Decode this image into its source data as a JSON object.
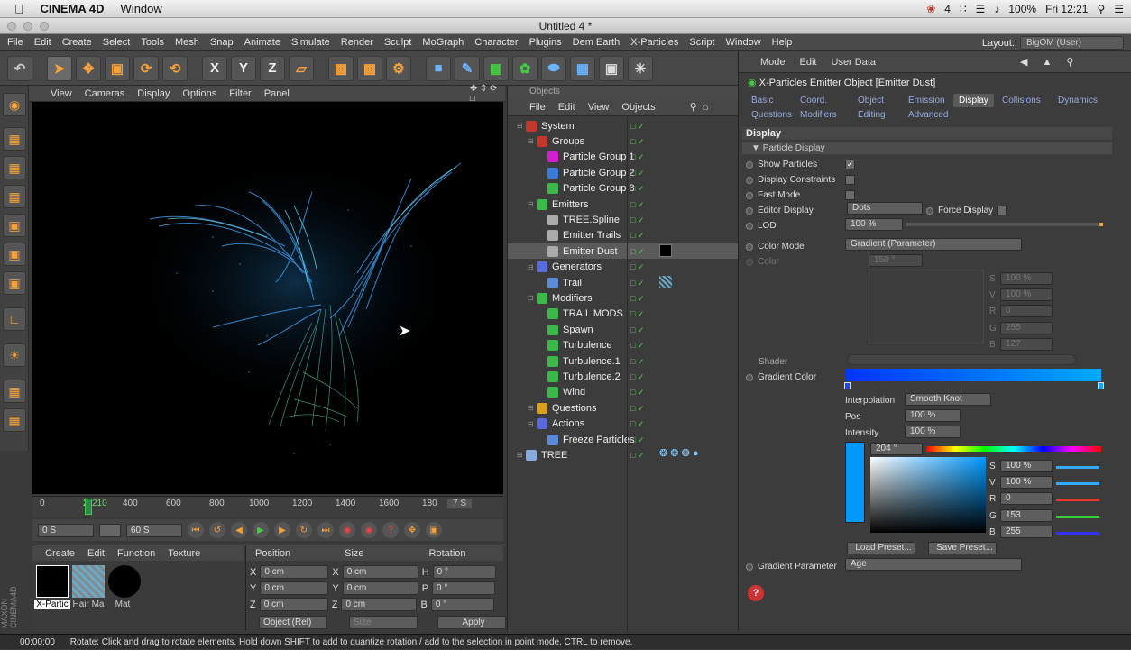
{
  "mac_menu": {
    "app": "CINEMA 4D",
    "window": "Window",
    "battery": "100%",
    "clock": "Fri 12:21",
    "counter": "4"
  },
  "window_title": "Untitled 4 *",
  "menu": [
    "File",
    "Edit",
    "Create",
    "Select",
    "Tools",
    "Mesh",
    "Snap",
    "Animate",
    "Simulate",
    "Render",
    "Sculpt",
    "MoGraph",
    "Character",
    "Plugins",
    "Dem Earth",
    "X-Particles",
    "Script",
    "Window",
    "Help"
  ],
  "layout": {
    "label": "Layout:",
    "value": "BigOM (User)"
  },
  "viewport_menu": [
    "View",
    "Cameras",
    "Display",
    "Options",
    "Filter",
    "Panel"
  ],
  "timeline": {
    "ticks": [
      "0",
      "2",
      "210",
      "400",
      "600",
      "800",
      "1000",
      "1200",
      "1400",
      "1600",
      "180"
    ],
    "frame_right": "7 S"
  },
  "playbar": {
    "start": "0 S",
    "end": "60 S"
  },
  "material_menu": [
    "Create",
    "Edit",
    "Function",
    "Texture"
  ],
  "materials": [
    {
      "label": "X-Partic"
    },
    {
      "label": "Hair Ma"
    },
    {
      "label": "Mat"
    }
  ],
  "coord": {
    "headers": [
      "Position",
      "Size",
      "Rotation"
    ],
    "rows": [
      {
        "a": "X",
        "pos": "0 cm",
        "b": "X",
        "size": "0 cm",
        "c": "H",
        "rot": "0 °"
      },
      {
        "a": "Y",
        "pos": "0 cm",
        "b": "Y",
        "size": "0 cm",
        "c": "P",
        "rot": "0 °"
      },
      {
        "a": "Z",
        "pos": "0 cm",
        "b": "Z",
        "size": "0 cm",
        "c": "B",
        "rot": "0 °"
      }
    ],
    "mode": "Object (Rel)",
    "size_mode": "Size",
    "apply": "Apply"
  },
  "objects": {
    "title": "Objects",
    "menu": [
      "File",
      "Edit",
      "View",
      "Objects"
    ],
    "tree": [
      {
        "name": "System",
        "indent": 0,
        "color": "#c0392b"
      },
      {
        "name": "Groups",
        "indent": 1,
        "color": "#c0392b"
      },
      {
        "name": "Particle Group 1",
        "indent": 2,
        "color": "#d020d0"
      },
      {
        "name": "Particle Group 2",
        "indent": 2,
        "color": "#3a7ad8"
      },
      {
        "name": "Particle Group 3",
        "indent": 2,
        "color": "#3ab84a"
      },
      {
        "name": "Emitters",
        "indent": 1,
        "color": "#3ab84a"
      },
      {
        "name": "TREE.Spline",
        "indent": 2,
        "color": "#aaaaaa"
      },
      {
        "name": "Emitter Trails",
        "indent": 2,
        "color": "#aaaaaa"
      },
      {
        "name": "Emitter Dust",
        "indent": 2,
        "color": "#aaaaaa"
      },
      {
        "name": "Generators",
        "indent": 1,
        "color": "#5a6ad8"
      },
      {
        "name": "Trail",
        "indent": 2,
        "color": "#5a8ad8"
      },
      {
        "name": "Modifiers",
        "indent": 1,
        "color": "#3ab84a"
      },
      {
        "name": "TRAIL MODS",
        "indent": 2,
        "color": "#3ab84a"
      },
      {
        "name": "Spawn",
        "indent": 2,
        "color": "#3ab84a"
      },
      {
        "name": "Turbulence",
        "indent": 2,
        "color": "#3ab84a"
      },
      {
        "name": "Turbulence.1",
        "indent": 2,
        "color": "#3ab84a"
      },
      {
        "name": "Turbulence.2",
        "indent": 2,
        "color": "#3ab84a"
      },
      {
        "name": "Wind",
        "indent": 2,
        "color": "#3ab84a"
      },
      {
        "name": "Questions",
        "indent": 1,
        "color": "#d8a020"
      },
      {
        "name": "Actions",
        "indent": 1,
        "color": "#5a6ad8"
      },
      {
        "name": "Freeze Particles",
        "indent": 2,
        "color": "#5a8ad8"
      },
      {
        "name": "TREE",
        "indent": 0,
        "color": "#88aadd"
      }
    ]
  },
  "attributes": {
    "menu": [
      "Mode",
      "Edit",
      "User Data"
    ],
    "object_title": "X-Particles Emitter Object [Emitter Dust]",
    "tabs_row1": [
      "Basic",
      "Coord.",
      "Object",
      "Emission",
      "Display",
      "Collisions",
      "Dynamics"
    ],
    "tabs_row2": [
      "Questions",
      "Modifiers",
      "Editing",
      "Advanced"
    ],
    "active_tab": "Display",
    "section": "Display",
    "subsection": "Particle Display",
    "show_particles": "Show Particles",
    "display_constraints": "Display Constraints",
    "fast_mode": "Fast Mode",
    "editor_display": "Editor Display",
    "editor_display_value": "Dots",
    "force_display": "Force Display",
    "lod": "LOD",
    "lod_value": "100 %",
    "color_mode": "Color Mode",
    "color_mode_value": "Gradient (Parameter)",
    "color": "Color",
    "color_h": "150 °",
    "color_fields": [
      {
        "label": "S",
        "value": "100 %"
      },
      {
        "label": "V",
        "value": "100 %"
      },
      {
        "label": "R",
        "value": "0"
      },
      {
        "label": "G",
        "value": "255"
      },
      {
        "label": "B",
        "value": "127"
      }
    ],
    "shader": "Shader",
    "gradient_color": "Gradient Color",
    "interpolation": "Interpolation",
    "interpolation_value": "Smooth Knot",
    "pos": "Pos",
    "pos_value": "100 %",
    "intensity": "Intensity",
    "intensity_value": "100 %",
    "hue": "204 °",
    "picker_fields": [
      {
        "label": "S",
        "value": "100 %"
      },
      {
        "label": "V",
        "value": "100 %"
      },
      {
        "label": "R",
        "value": "0"
      },
      {
        "label": "G",
        "value": "153"
      },
      {
        "label": "B",
        "value": "255"
      }
    ],
    "load_preset": "Load Preset...",
    "save_preset": "Save Preset...",
    "gradient_parameter": "Gradient Parameter",
    "gradient_parameter_value": "Age"
  },
  "status": {
    "time": "00:00:00",
    "message": "Rotate: Click and drag to rotate elements. Hold down SHIFT to add to quantize rotation / add to the selection in point mode, CTRL to remove."
  },
  "colors": {
    "accent": "#f6a13a",
    "gradient_start": "#0033ff",
    "gradient_end": "#00aaff"
  }
}
